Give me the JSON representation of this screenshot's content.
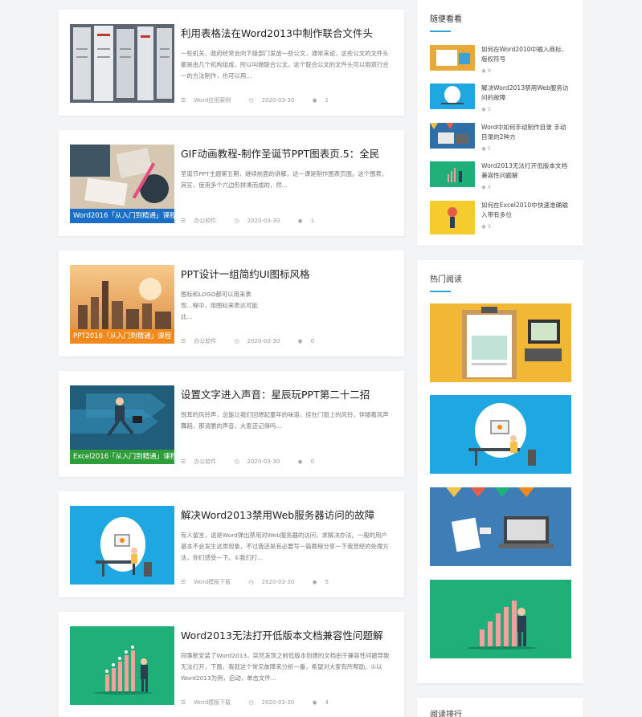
{
  "articles": [
    {
      "title": "利用表格法在Word2013中制作联合文件头",
      "excerpt": "一些机关、政府经常会向下级部门发放一些公文，通常来说，这些公文的文件头都是由几个机构组成，所以叫做联合公文。这个联合公文的文件头可以用双行合一的方法制作，也可以用...",
      "category": "Word应用案例",
      "date": "2020-03-30",
      "views": "1",
      "ribbon": ""
    },
    {
      "title": "GIF动画教程-制作圣诞节PPT图表页.5：全民",
      "excerpt": "圣诞节PPT主题第五期，继续前面的讲解，这一课是制作图表页面。这个图表，其实，使用多个六边形拼凑而成的，然...",
      "category": "办公软件",
      "date": "2020-03-30",
      "views": "1",
      "ribbon": "Word2016「从入门到精通」课程"
    },
    {
      "title": "PPT设计一组简约UI图标风格",
      "excerpt": "图标和LOGO都可以用来表现...程中，用图标来表达可能比...",
      "category": "办公软件",
      "date": "2020-03-30",
      "views": "0",
      "ribbon": "PPT2016「从入门到精通」课程"
    },
    {
      "title": "设置文字进入声音：星辰玩PPT第二十二招",
      "excerpt": "悦耳的风铃声，总能让我们回想起童年的味道，挂在门窗上的风铃，伴随着风声舞蹈，那清脆的声音，大家还记得吗...",
      "category": "办公软件",
      "date": "2020-03-30",
      "views": "0",
      "ribbon": "Excel2016「从入门到精通」课程"
    },
    {
      "title": "解决Word2013禁用Web服务器访问的故障",
      "excerpt": "有人留言，说是Word弹出禁用对Web服务器的访问，求解决办法。一般的用户基本不会发生这类现象，不过我还是有必要写一篇教程分享一下我曾经的处理方法，你们感受一下。①我们打...",
      "category": "Word模板下载",
      "date": "2020-03-30",
      "views": "5",
      "ribbon": ""
    },
    {
      "title": "Word2013无法打开低版本文档兼容性问题解",
      "excerpt": "同事新安装了Word2013，突然发现之前低版本创建的文档由于兼容性问题导致无法打开，下面，我就这个常见故障来分析一番，希望对大家有所帮助。①以Word2013为例，启动，单击文件...",
      "category": "Word模板下载",
      "date": "2020-03-30",
      "views": "4",
      "ribbon": ""
    }
  ],
  "random": {
    "heading": "随便看看",
    "items": [
      {
        "title": "如何在Word2010中输入商标、版权符号",
        "views": "8"
      },
      {
        "title": "解决Word2013禁用Web服务访问的故障",
        "views": "5"
      },
      {
        "title": "Word中如何手动制作目录 手动目录的2种方",
        "views": "5"
      },
      {
        "title": "Word2013无法打开低版本文档兼容性问题解",
        "views": "4"
      },
      {
        "title": "如何在Excel2010中快速准确输入带有多位",
        "views": "3"
      }
    ]
  },
  "hot": {
    "heading": "热门阅读"
  },
  "ranking": {
    "heading": "阅读排行"
  },
  "colors": {
    "accent": "#29a6d9",
    "ribbon_word": "#1a6fc4",
    "ribbon_ppt": "#f08a1c",
    "ribbon_excel": "#2e9d3a",
    "teal": "#1fb07a",
    "sky": "#1ea7e1"
  }
}
